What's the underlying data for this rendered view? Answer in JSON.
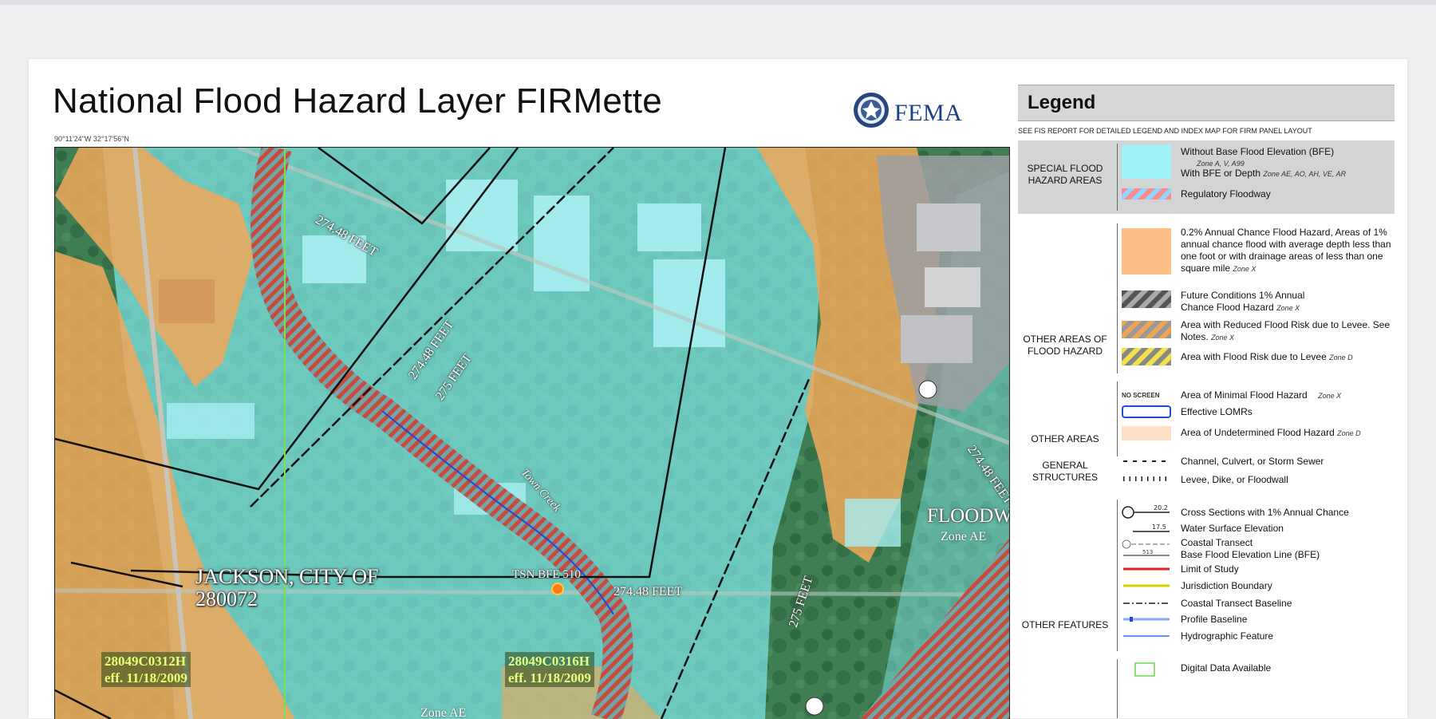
{
  "document": {
    "title": "National Flood Hazard Layer FIRMette",
    "coordinates": "90°11'24\"W 32°17'56\"N",
    "agency_logo_text": "FEMA"
  },
  "map": {
    "community_label_line1": "JACKSON, CITY OF",
    "community_label_line2": "280072",
    "floodway_label": "FLOODWAY",
    "zone_ae_label": "Zone AE",
    "zone_ae_label_2": "Zone AE",
    "bfe_point_label": "TSN BFE 510",
    "bfe_lines": [
      "274.48 FEET",
      "274.48 FEET",
      "275 FEET",
      "274.48 FEET",
      "275 FEET",
      "274.48 FEET"
    ],
    "stream_name": "Town Creek",
    "panels": [
      {
        "number": "28049C0312H",
        "effective": "eff. 11/18/2009"
      },
      {
        "number": "28049C0316H",
        "effective": "eff. 11/18/2009"
      }
    ],
    "colors": {
      "zone_ae": "#7fe4e8",
      "zone_x_shaded": "#f0a85a",
      "floodway_hatch": "#d8473e",
      "boundary": "#111111",
      "jurisdiction_line": "#7be04f"
    }
  },
  "legend": {
    "title": "Legend",
    "note": "SEE FIS REPORT FOR DETAILED LEGEND AND INDEX MAP FOR FIRM PANEL LAYOUT",
    "categories": {
      "sfha": "SPECIAL FLOOD HAZARD AREAS",
      "other_areas_of_flood_hazard": "OTHER AREAS OF FLOOD HAZARD",
      "other_areas": "OTHER AREAS",
      "general_structures": "GENERAL STRUCTURES",
      "other_features": "OTHER FEATURES"
    },
    "sfha_items": [
      {
        "label": "Without Base Flood Elevation (BFE)",
        "zone": "Zone A, V, A99"
      },
      {
        "label": "With BFE or Depth",
        "zone": "Zone AE, AO, AH, VE, AR"
      },
      {
        "label": "Regulatory Floodway",
        "zone": ""
      }
    ],
    "flood_hazard_items": [
      {
        "label": "0.2% Annual Chance Flood Hazard, Areas of 1% annual chance flood with average depth less than one foot or with drainage areas of less than one square mile",
        "zone": "Zone X"
      },
      {
        "label": "Future Conditions 1% Annual Chance Flood Hazard",
        "zone": "Zone X"
      },
      {
        "label": "Area with Reduced Flood Risk due to Levee. See Notes.",
        "zone": "Zone X"
      },
      {
        "label": "Area with Flood Risk due to Levee",
        "zone": "Zone D"
      }
    ],
    "other_area_items": [
      {
        "swatch": "NO SCREEN",
        "label": "Area of Minimal Flood Hazard",
        "zone": "Zone X"
      },
      {
        "label": "Effective LOMRs",
        "zone": ""
      },
      {
        "label": "Area of Undetermined Flood Hazard",
        "zone": "Zone D"
      }
    ],
    "structure_items": [
      {
        "label": "Channel, Culvert, or Storm Sewer"
      },
      {
        "label": "Levee, Dike, or Floodwall"
      }
    ],
    "feature_items": [
      {
        "symbol_text": "20.2",
        "label": "Cross Sections with 1% Annual Chance"
      },
      {
        "symbol_text": "17.5",
        "label": "Water Surface Elevation"
      },
      {
        "label": "Coastal Transect"
      },
      {
        "symbol_text": "513",
        "label": "Base Flood Elevation Line (BFE)"
      },
      {
        "label": "Limit of Study"
      },
      {
        "label": "Jurisdiction Boundary"
      },
      {
        "label": "Coastal Transect Baseline"
      },
      {
        "label": "Profile Baseline"
      },
      {
        "label": "Hydrographic Feature"
      }
    ],
    "map_panels_items": [
      {
        "label": "Digital Data Available"
      }
    ]
  }
}
